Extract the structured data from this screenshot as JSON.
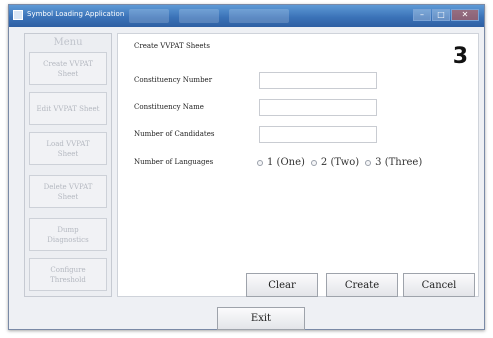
{
  "window": {
    "title": "Symbol Loading Application",
    "minimize": "–",
    "maximize": "□",
    "close": "✕"
  },
  "menu": {
    "title": "Menu",
    "items": [
      {
        "label": "Create VVPAT Sheet"
      },
      {
        "label": "Edit VVPAT Sheet"
      },
      {
        "label": "Load VVPAT Sheet"
      },
      {
        "label": "Delete VVPAT Sheet"
      },
      {
        "label": "Dump Diagnostics"
      },
      {
        "label": "Configure Threshold"
      }
    ]
  },
  "form": {
    "title": "Create VVPAT Sheets",
    "step_number": "3",
    "fields": {
      "constituency_number": {
        "label": "Constituency Number",
        "value": ""
      },
      "constituency_name": {
        "label": "Constituency Name",
        "value": ""
      },
      "number_of_candidates": {
        "label": "Number of Candidates",
        "value": ""
      }
    },
    "languages": {
      "label": "Number of Languages",
      "options": [
        "1 (One)",
        "2 (Two)",
        "3 (Three)"
      ],
      "selected": null
    }
  },
  "actions": {
    "clear": "Clear",
    "create": "Create",
    "cancel": "Cancel",
    "exit": "Exit"
  }
}
